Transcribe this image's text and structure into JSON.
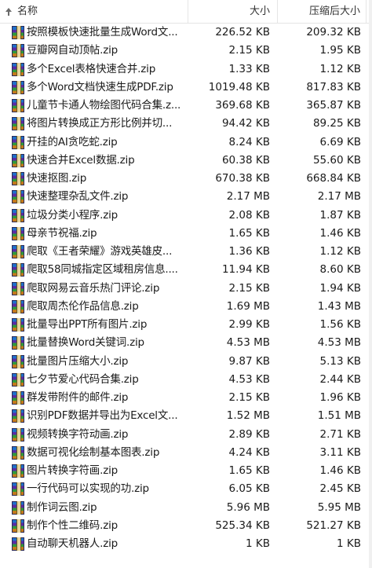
{
  "header": {
    "name_label": "名称",
    "size_label": "大小",
    "compressed_label": "压缩后大小",
    "sort_icon": "sort-up-arrow-icon"
  },
  "file_icon": "winrar-archive-icon",
  "files": [
    {
      "name": "按照模板快速批量生成Word文...",
      "size": "226.52 KB",
      "compressed": "209.32 KB"
    },
    {
      "name": "豆瓣网自动顶帖.zip",
      "size": "2.15 KB",
      "compressed": "1.95 KB"
    },
    {
      "name": "多个Excel表格快速合并.zip",
      "size": "1.33 KB",
      "compressed": "1.12 KB"
    },
    {
      "name": "多个Word文档快速生成PDF.zip",
      "size": "1019.48 KB",
      "compressed": "817.83 KB"
    },
    {
      "name": "儿童节卡通人物绘图代码合集.z...",
      "size": "369.68 KB",
      "compressed": "365.87 KB"
    },
    {
      "name": "将图片转换成正方形比例并切...",
      "size": "94.42 KB",
      "compressed": "89.25 KB"
    },
    {
      "name": "开挂的AI贪吃蛇.zip",
      "size": "8.24 KB",
      "compressed": "6.69 KB"
    },
    {
      "name": "快速合并Excel数据.zip",
      "size": "60.38 KB",
      "compressed": "55.60 KB"
    },
    {
      "name": "快速抠图.zip",
      "size": "670.38 KB",
      "compressed": "668.84 KB"
    },
    {
      "name": "快速整理杂乱文件.zip",
      "size": "2.17 MB",
      "compressed": "2.17 MB"
    },
    {
      "name": "垃圾分类小程序.zip",
      "size": "2.08 KB",
      "compressed": "1.87 KB"
    },
    {
      "name": "母亲节祝福.zip",
      "size": "1.65 KB",
      "compressed": "1.46 KB"
    },
    {
      "name": "爬取《王者荣耀》游戏英雄皮...",
      "size": "1.36 KB",
      "compressed": "1.12 KB"
    },
    {
      "name": "爬取58同城指定区域租房信息....",
      "size": "11.94 KB",
      "compressed": "8.60 KB"
    },
    {
      "name": "爬取网易云音乐热门评论.zip",
      "size": "2.15 KB",
      "compressed": "1.94 KB"
    },
    {
      "name": "爬取周杰伦作品信息.zip",
      "size": "1.69 MB",
      "compressed": "1.43 MB"
    },
    {
      "name": "批量导出PPT所有图片.zip",
      "size": "2.99 KB",
      "compressed": "1.56 KB"
    },
    {
      "name": "批量替换Word关键词.zip",
      "size": "4.53 MB",
      "compressed": "4.53 MB"
    },
    {
      "name": "批量图片压缩大小.zip",
      "size": "9.87 KB",
      "compressed": "5.13 KB"
    },
    {
      "name": "七夕节爱心代码合集.zip",
      "size": "4.53 KB",
      "compressed": "2.44 KB"
    },
    {
      "name": "群发带附件的邮件.zip",
      "size": "2.15 KB",
      "compressed": "1.96 KB"
    },
    {
      "name": "识别PDF数据并导出为Excel文...",
      "size": "1.52 MB",
      "compressed": "1.51 MB"
    },
    {
      "name": "视频转换字符动画.zip",
      "size": "2.89 KB",
      "compressed": "2.71 KB"
    },
    {
      "name": "数据可视化绘制基本图表.zip",
      "size": "4.24 KB",
      "compressed": "3.11 KB"
    },
    {
      "name": "图片转换字符画.zip",
      "size": "1.65 KB",
      "compressed": "1.46 KB"
    },
    {
      "name": "一行代码可以实现的功.zip",
      "size": "6.05 KB",
      "compressed": "2.45 KB"
    },
    {
      "name": "制作词云图.zip",
      "size": "5.96 MB",
      "compressed": "5.95 MB"
    },
    {
      "name": "制作个性二维码.zip",
      "size": "525.34 KB",
      "compressed": "521.27 KB"
    },
    {
      "name": "自动聊天机器人.zip",
      "size": "1 KB",
      "compressed": "1 KB"
    }
  ]
}
